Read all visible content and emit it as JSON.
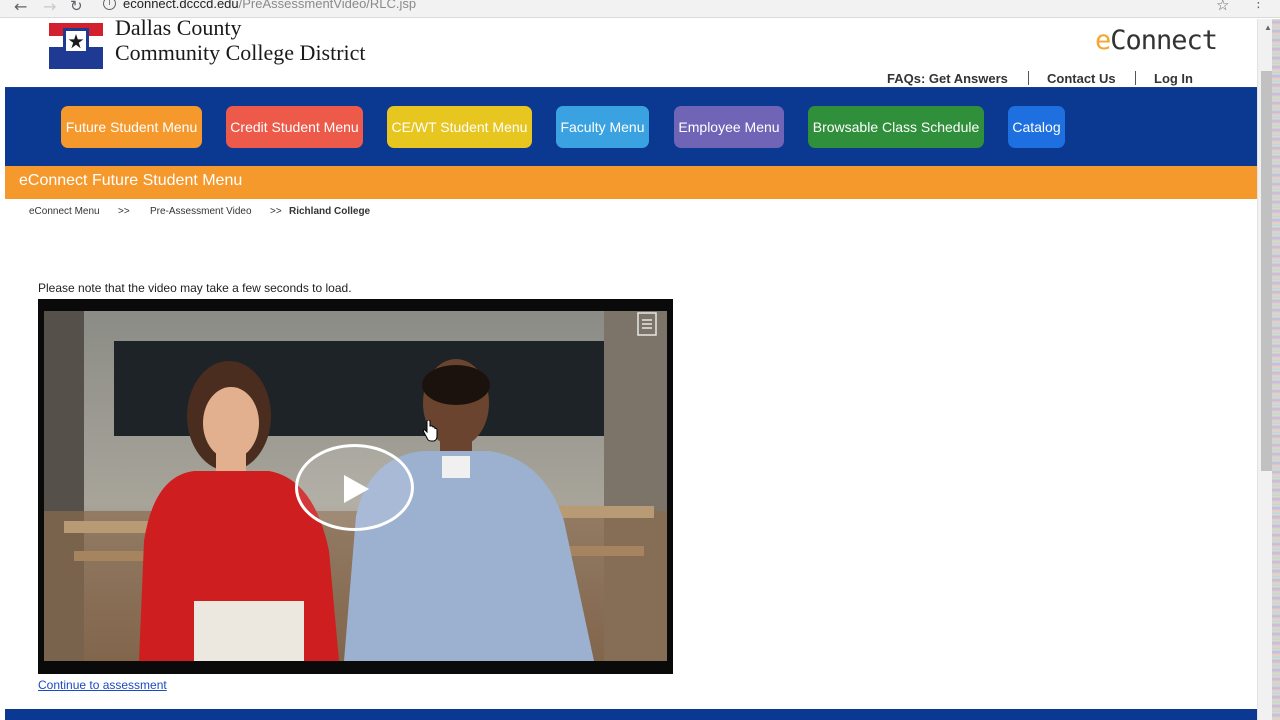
{
  "browser": {
    "url_domain": "econnect.dcccd.edu",
    "url_path": "/PreAssessmentVideo/RLC.jsp"
  },
  "header": {
    "logo_line1": "Dallas County",
    "logo_line2": "Community College District",
    "econnect_e": "e",
    "econnect_rest": "Connect",
    "links": {
      "faqs": "FAQs: Get Answers",
      "contact": "Contact Us",
      "login": "Log In"
    }
  },
  "nav": {
    "future_student": "Future Student Menu",
    "credit_student": "Credit Student Menu",
    "cewt_student": "CE/WT Student Menu",
    "faculty": "Faculty Menu",
    "employee": "Employee Menu",
    "class_schedule": "Browsable Class Schedule",
    "catalog": "Catalog"
  },
  "nav_colors": {
    "future_student": "#f5992d",
    "credit_student": "#ee5a49",
    "cewt_student": "#e7c61f",
    "faculty": "#3aa2e0",
    "employee": "#7064b7",
    "class_schedule": "#2f8f3a",
    "catalog": "#1e6fe0"
  },
  "section": {
    "title": "eConnect Future Student Menu"
  },
  "breadcrumb": {
    "item1": "eConnect Menu",
    "sep1": ">>",
    "item2": "Pre-Assessment Video",
    "sep2": ">>",
    "current": "Richland College"
  },
  "main": {
    "note": "Please note that the video may take a few seconds to load.",
    "continue_link": "Continue to assessment"
  },
  "icons": {
    "back": "arrow-left-icon",
    "forward": "arrow-right-icon",
    "reload": "reload-icon",
    "info": "info-icon",
    "bookmark": "star-icon",
    "menu": "kebab-menu-icon",
    "play": "play-icon",
    "transcript": "transcript-icon"
  }
}
